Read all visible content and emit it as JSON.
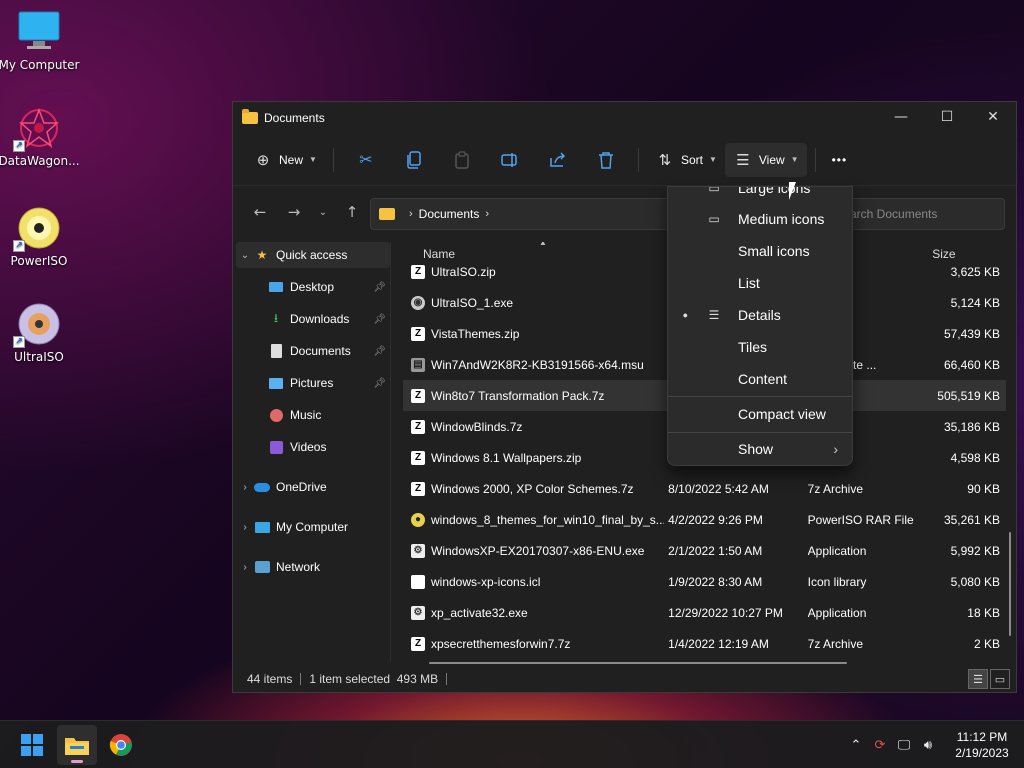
{
  "desktop": {
    "icons": [
      {
        "label": "My Computer"
      },
      {
        "label": "DataWagon..."
      },
      {
        "label": "PowerISO"
      },
      {
        "label": "UltraISO"
      }
    ]
  },
  "window": {
    "title": "Documents",
    "controls": {
      "minimize": "—",
      "maximize": "☐",
      "close": "✕"
    }
  },
  "toolbar": {
    "new_label": "New",
    "sort_label": "Sort",
    "view_label": "View",
    "more_label": "•••"
  },
  "address": {
    "segments": [
      "Documents"
    ],
    "search_placeholder": "Search Documents",
    "search_visible_text": "arch Documents"
  },
  "sidebar": {
    "quick_access": "Quick access",
    "pinned": [
      {
        "label": "Desktop"
      },
      {
        "label": "Downloads"
      },
      {
        "label": "Documents"
      },
      {
        "label": "Pictures"
      },
      {
        "label": "Music"
      },
      {
        "label": "Videos"
      }
    ],
    "onedrive": "OneDrive",
    "my_computer": "My Computer",
    "network": "Network"
  },
  "filelist": {
    "columns": {
      "name": "Name",
      "date": "",
      "type": "",
      "size": "Size"
    },
    "rows": [
      {
        "name": "UltraISO.zip",
        "date": "",
        "type": "rchive",
        "size": "3,625 KB"
      },
      {
        "name": "UltraISO_1.exe",
        "date": "",
        "type": "ation",
        "size": "5,124 KB"
      },
      {
        "name": "VistaThemes.zip",
        "date": "",
        "type": "hive",
        "size": "57,439 KB"
      },
      {
        "name": "Win7AndW2K8R2-KB3191566-x64.msu",
        "date": "",
        "type": "oft Update ...",
        "size": "66,460 KB"
      },
      {
        "name": "Win8to7 Transformation Pack.7z",
        "date": "",
        "type": "ive",
        "size": "505,519 KB"
      },
      {
        "name": "WindowBlinds.7z",
        "date": "",
        "type": "ive",
        "size": "35,186 KB"
      },
      {
        "name": "Windows 8.1 Wallpapers.zip",
        "date": "",
        "type": "hive",
        "size": "4,598 KB"
      },
      {
        "name": "Windows 2000, XP Color Schemes.7z",
        "date": "8/10/2022 5:42 AM",
        "type": "7z Archive",
        "size": "90 KB"
      },
      {
        "name": "windows_8_themes_for_win10_final_by_s...",
        "date": "4/2/2022 9:26 PM",
        "type": "PowerISO RAR File",
        "size": "35,261 KB"
      },
      {
        "name": "WindowsXP-EX20170307-x86-ENU.exe",
        "date": "2/1/2022 1:50 AM",
        "type": "Application",
        "size": "5,992 KB"
      },
      {
        "name": "windows-xp-icons.icl",
        "date": "1/9/2022 8:30 AM",
        "type": "Icon library",
        "size": "5,080 KB"
      },
      {
        "name": "xp_activate32.exe",
        "date": "12/29/2022 10:27 PM",
        "type": "Application",
        "size": "18 KB"
      },
      {
        "name": "xpsecretthemesforwin7.7z",
        "date": "1/4/2022 12:19 AM",
        "type": "7z Archive",
        "size": "2 KB"
      }
    ]
  },
  "status": {
    "items": "44 items",
    "selection": "1 item selected  493 MB"
  },
  "view_menu": {
    "items": [
      "Large icons",
      "Medium icons",
      "Small icons",
      "List",
      "Details",
      "Tiles",
      "Content",
      "Compact view",
      "Show"
    ],
    "selected": "Details",
    "bullet": "●",
    "submenu_arrow": "›"
  },
  "taskbar": {
    "time": "11:12 PM",
    "date": "2/19/2023"
  },
  "colors": {
    "accent": "#4fa3ef",
    "window_bg": "#202020",
    "menu_bg": "#2b2b2b",
    "folder": "#f5c242"
  }
}
